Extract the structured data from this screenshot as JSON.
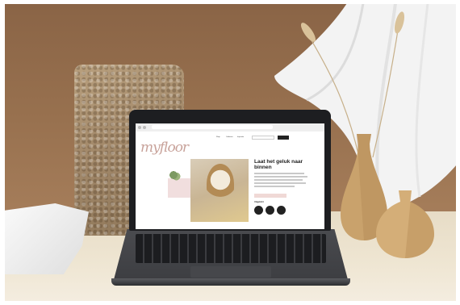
{
  "scene": {
    "colors": {
      "wall": "#98714f",
      "table": "#efe6d3",
      "laptop_body": "#3b3c40",
      "brand_pink": "#c8a29a"
    }
  },
  "website": {
    "logo_text": "myfloor",
    "headline": "Laat het geluk naar binnen",
    "nav_items": [
      "Shop",
      "Collecties",
      "Inspiratie",
      "Over ons"
    ],
    "section_label": "Uitgelicht"
  }
}
